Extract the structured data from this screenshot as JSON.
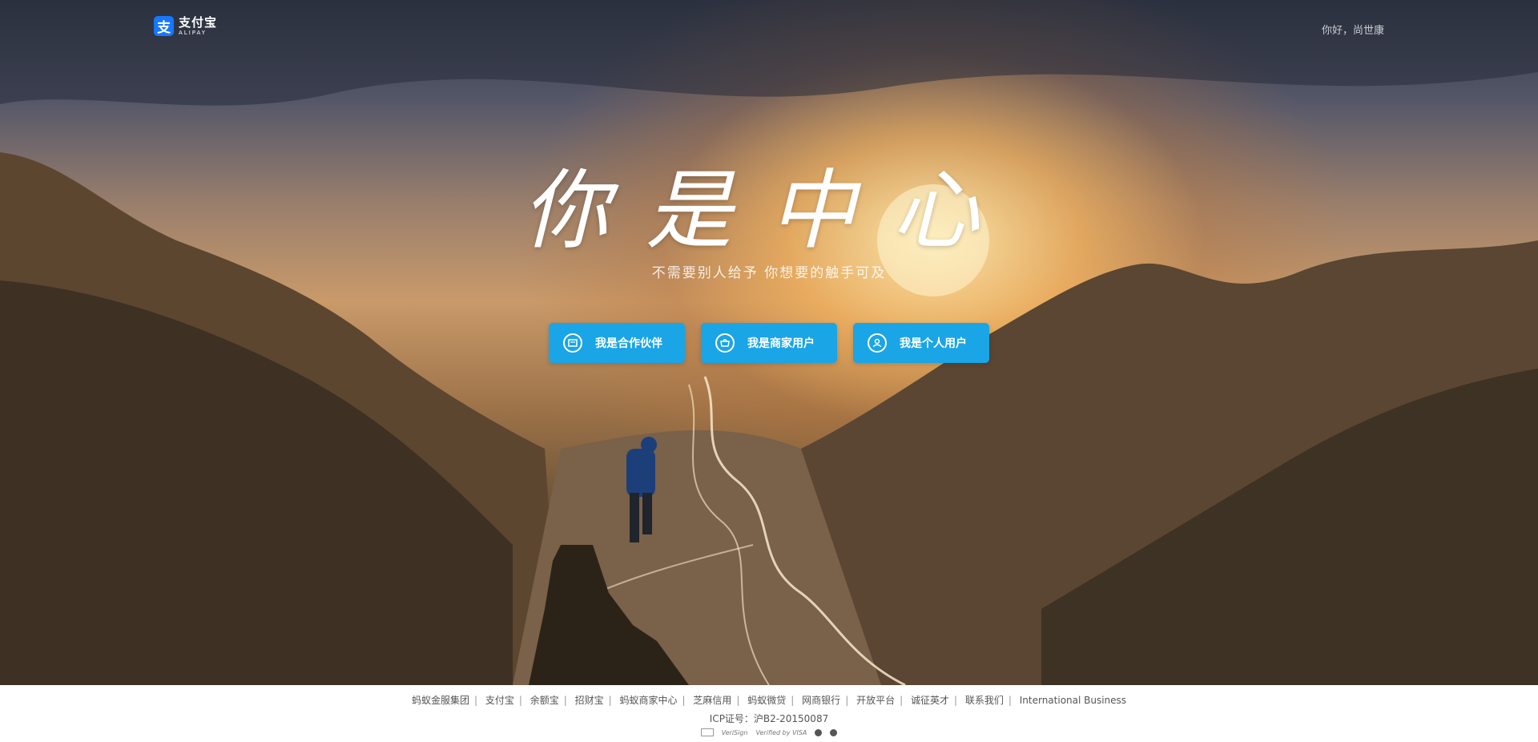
{
  "header": {
    "logo_cn": "支付宝",
    "logo_en": "ALIPAY",
    "greeting": "你好，尚世康"
  },
  "hero": {
    "headline": "你是中心",
    "subline": "不需要别人给予  你想要的触手可及"
  },
  "roles": [
    {
      "label": "我是合作伙伴",
      "icon": "partner-icon"
    },
    {
      "label": "我是商家用户",
      "icon": "merchant-icon"
    },
    {
      "label": "我是个人用户",
      "icon": "user-icon"
    }
  ],
  "footer": {
    "links": [
      "蚂蚁金服集团",
      "支付宝",
      "余额宝",
      "招财宝",
      "蚂蚁商家中心",
      "芝麻信用",
      "蚂蚁微贷",
      "网商银行",
      "开放平台",
      "诚征英才",
      "联系我们",
      "International Business"
    ],
    "icp": "ICP证号：沪B2-20150087",
    "certs": {
      "verisign": "VeriSign",
      "visa": "Verified by VISA"
    }
  },
  "colors": {
    "button": "#1aa5e6",
    "logo": "#1677ff"
  }
}
